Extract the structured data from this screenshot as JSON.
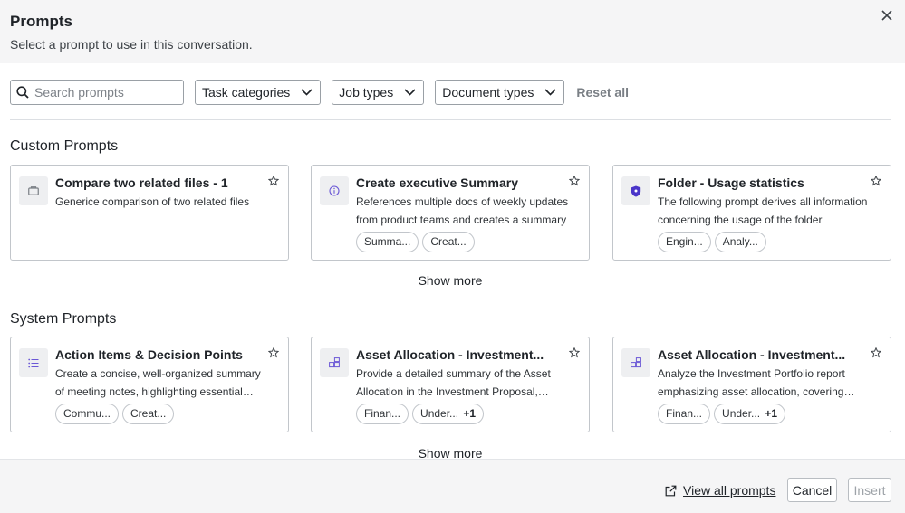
{
  "dialog": {
    "title": "Prompts",
    "subtitle": "Select a prompt to use in this conversation."
  },
  "filters": {
    "search_placeholder": "Search prompts",
    "search_value": "",
    "dropdowns": [
      "Task categories",
      "Job types",
      "Document types"
    ],
    "reset_label": "Reset all"
  },
  "custom": {
    "heading": "Custom Prompts",
    "cards": [
      {
        "title": "Compare two related files - 1",
        "description": "Generice comparison of two related files",
        "icon": "folder-icon",
        "tags": []
      },
      {
        "title": "Create executive Summary",
        "description": "References multiple docs of weekly updates from product teams and creates a summary",
        "icon": "info-icon",
        "tags": [
          "Summa...",
          "Creat..."
        ]
      },
      {
        "title": "Folder - Usage statistics",
        "description": "The following prompt derives all information concerning the usage of the folder",
        "icon": "shield-icon",
        "tags": [
          "Engin...",
          "Analy..."
        ]
      }
    ],
    "show_more": "Show more"
  },
  "system": {
    "heading": "System Prompts",
    "cards": [
      {
        "title": "Action Items & Decision Points",
        "description": "Create a concise, well-organized summary of meeting notes, highlighting essential action items",
        "icon": "list-icon",
        "tags": [
          "Commu...",
          "Creat..."
        ]
      },
      {
        "title": "Asset Allocation - Investment...",
        "description": "Provide a detailed summary of the Asset Allocation in the Investment Proposal, including details",
        "icon": "widgets-icon",
        "tags": [
          "Finan...",
          "Under..."
        ],
        "extra_count": "+1"
      },
      {
        "title": "Asset Allocation - Investment...",
        "description": "Analyze the Investment Portfolio report emphasizing asset allocation, covering details",
        "icon": "widgets-icon",
        "tags": [
          "Finan...",
          "Under..."
        ],
        "extra_count": "+1"
      }
    ],
    "show_more": "Show more"
  },
  "footer": {
    "view_all": "View all prompts",
    "cancel": "Cancel",
    "insert": "Insert"
  },
  "colors": {
    "accent_shield": "#4a35c9",
    "icon_muted": "#7a7f85",
    "icon_purple": "#6b58d6",
    "header_bg": "#f5f5f6"
  }
}
